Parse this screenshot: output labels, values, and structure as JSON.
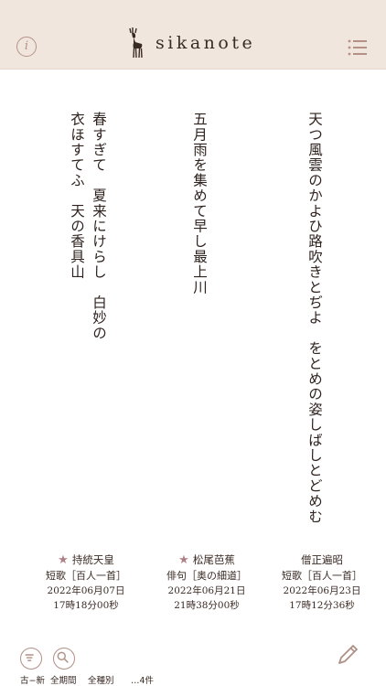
{
  "app": {
    "title": "sikanote"
  },
  "poems": [
    {
      "text": "天つ風雲のかよひ路吹きとぢよ　をとめの姿しばしとどめむ",
      "author": "僧正遍昭",
      "starred": false,
      "kind": "短歌［百人一首］",
      "date": "2022年06月23日",
      "time": "17時12分36秒"
    },
    {
      "text": "五月雨を集めて早し最上川",
      "author": "松尾芭蕉",
      "starred": true,
      "kind": "俳句［奥の細道］",
      "date": "2022年06月21日",
      "time": "21時38分00秒"
    },
    {
      "line1": "春すぎて　夏来にけらし　白妙の",
      "line2": "衣ほすてふ　天の香具山",
      "author": "持統天皇",
      "starred": true,
      "kind": "短歌［百人一首］",
      "date": "2022年06月07日",
      "time": "17時18分00秒"
    }
  ],
  "toolbar": {
    "sort_label": "古−新",
    "period_label": "全期間",
    "kind_label": "全種別",
    "count_label": "…4件"
  },
  "colors": {
    "header_bg": "#f1e6de",
    "accent": "#b08f86",
    "star": "#b07f86"
  },
  "icons": [
    "info-icon",
    "deer-logo-icon",
    "list-menu-icon",
    "sort-filter-icon",
    "search-icon",
    "pen-icon",
    "star-icon"
  ]
}
